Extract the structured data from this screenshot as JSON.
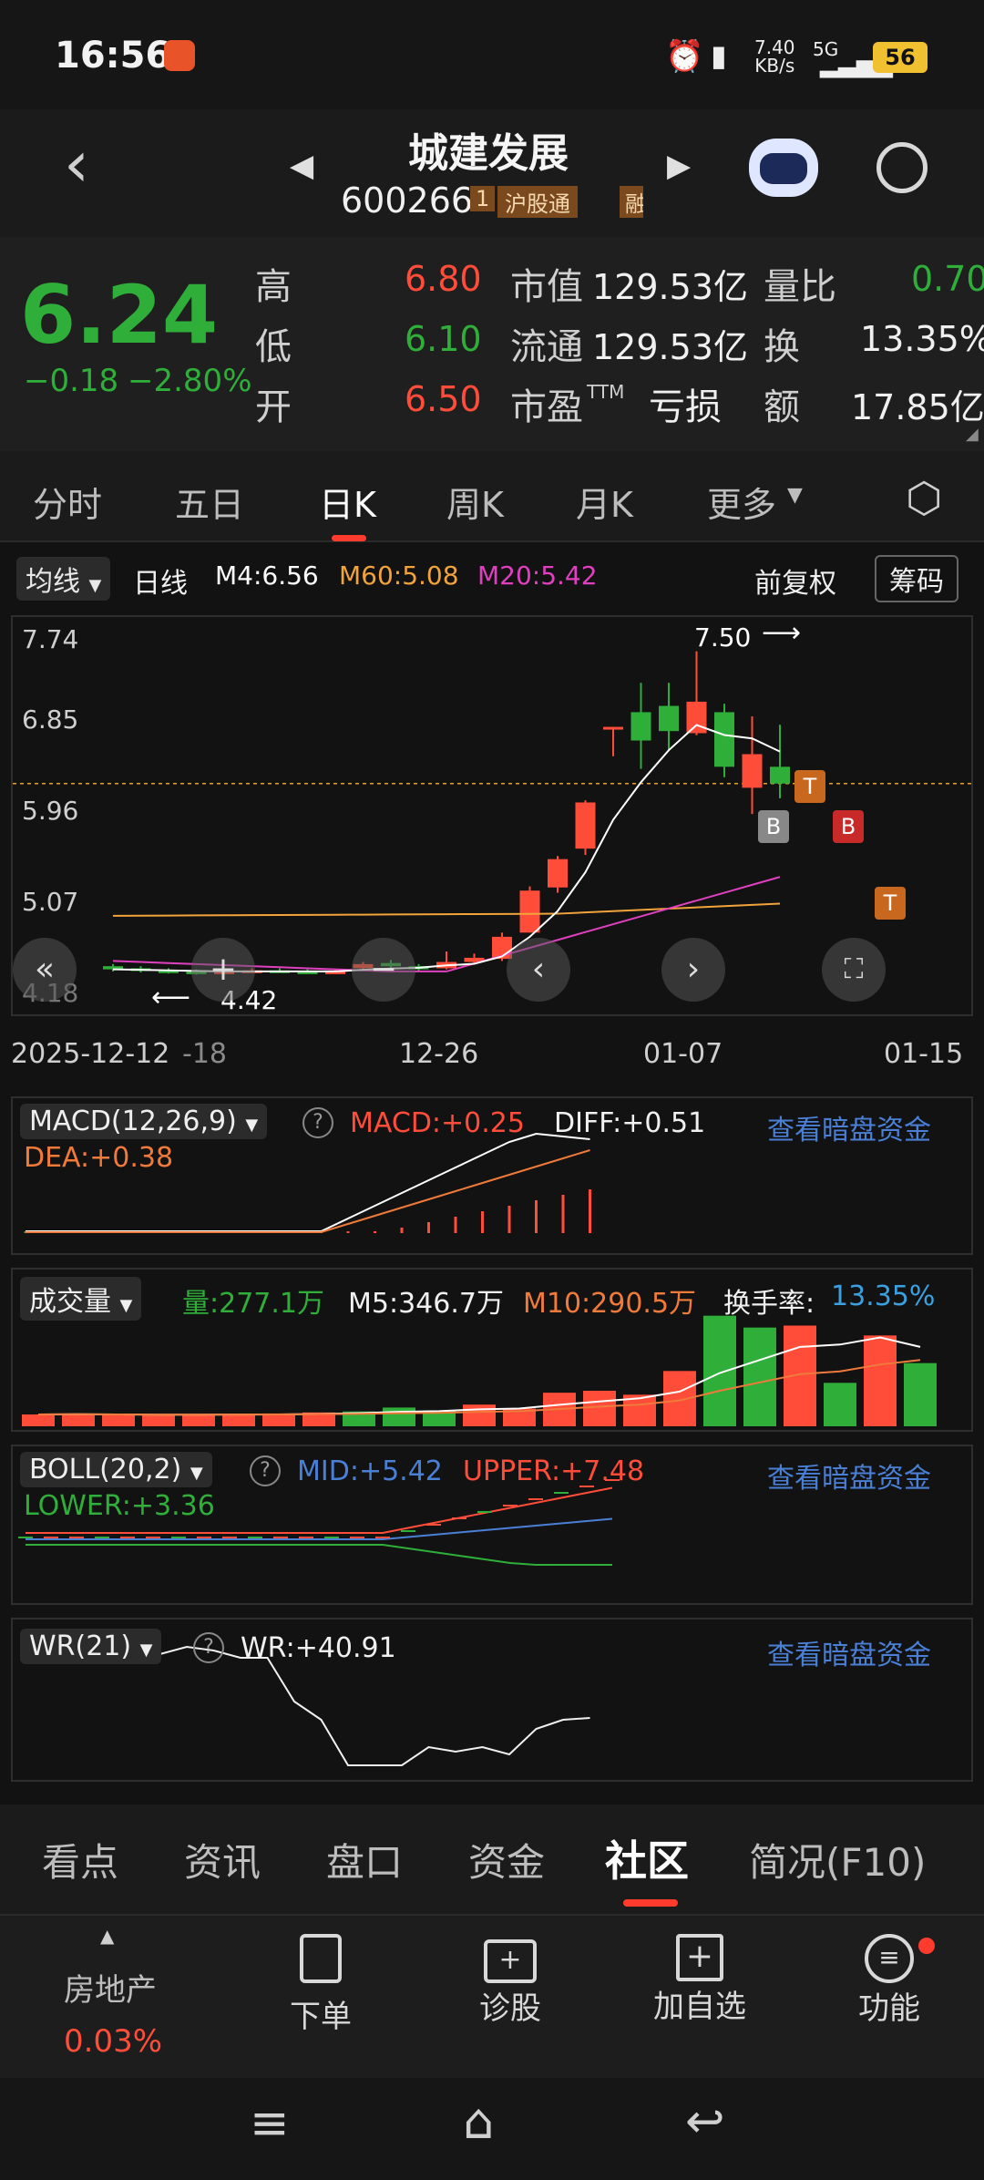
{
  "status_bar": {
    "time": "16:56",
    "net_speed": "7.40",
    "net_unit": "KB/s",
    "network": "5G",
    "battery": "56"
  },
  "header": {
    "stock_name": "城建发展",
    "stock_code": "600266",
    "tag1": "1",
    "tag2": "沪股通",
    "tag3": "融"
  },
  "quote": {
    "price": "6.24",
    "change": "−0.18",
    "change_pct": "−2.80%",
    "high_label": "高",
    "high": "6.80",
    "low_label": "低",
    "low": "6.10",
    "open_label": "开",
    "open": "6.50",
    "mcap_label": "市值",
    "mcap": "129.53亿",
    "float_label": "流通",
    "float": "129.53亿",
    "pe_label": "市盈",
    "pe_sup": "TTM",
    "pe": "亏损",
    "vr_label": "量比",
    "vr": "0.70",
    "turnover_label": "换",
    "turnover": "13.35%",
    "amount_label": "额",
    "amount": "17.85亿"
  },
  "period_tabs": [
    "分时",
    "五日",
    "日K",
    "周K",
    "月K",
    "更多"
  ],
  "kline": {
    "ma_selector": "均线",
    "period": "日线",
    "m4": "M4:6.56",
    "m60": "M60:5.08",
    "m20": "M20:5.42",
    "adjust": "前复权",
    "chip_button": "筹码",
    "y_ticks": [
      "7.74",
      "6.85",
      "5.96",
      "5.07",
      "4.18"
    ],
    "max_label": "7.50",
    "min_label": "4.42",
    "x_ticks": [
      "2025-12-12",
      "-18",
      "12-26",
      "01-07",
      "01-15"
    ],
    "markers": [
      "B",
      "T",
      "B",
      "T"
    ]
  },
  "macd": {
    "name": "MACD(12,26,9)",
    "macd": "MACD:+0.25",
    "diff": "DIFF:+0.51",
    "dea": "DEA:+0.38",
    "link": "查看暗盘资金"
  },
  "volume": {
    "name": "成交量",
    "vol": "量:277.1万",
    "m5": "M5:346.7万",
    "m10": "M10:290.5万",
    "turnover_label": "换手率:",
    "turnover": "13.35%"
  },
  "boll": {
    "name": "BOLL(20,2)",
    "mid": "MID:+5.42",
    "upper": "UPPER:+7.48",
    "lower": "LOWER:+3.36",
    "link": "查看暗盘资金"
  },
  "wr": {
    "name": "WR(21)",
    "wr": "WR:+40.91",
    "link": "查看暗盘资金"
  },
  "bottom_tabs": [
    "看点",
    "资讯",
    "盘口",
    "资金",
    "社区",
    "简况(F10)"
  ],
  "toolbar": {
    "sector_name": "房地产",
    "sector_change": "0.03%",
    "order": "下单",
    "diagnose": "诊股",
    "add_watch": "加自选",
    "functions": "功能"
  },
  "colors": {
    "up": "#ff4d3a",
    "down": "#2fae3a",
    "accent": "#4a7fd6"
  },
  "chart_data": {
    "type": "candlestick",
    "y_range": [
      4.18,
      7.74
    ],
    "candles": [
      {
        "o": 4.5,
        "c": 4.47,
        "h": 4.52,
        "l": 4.45
      },
      {
        "o": 4.48,
        "c": 4.46,
        "h": 4.5,
        "l": 4.44
      },
      {
        "o": 4.46,
        "c": 4.45,
        "h": 4.48,
        "l": 4.43
      },
      {
        "o": 4.45,
        "c": 4.44,
        "h": 4.47,
        "l": 4.42
      },
      {
        "o": 4.44,
        "c": 4.45,
        "h": 4.47,
        "l": 4.43
      },
      {
        "o": 4.45,
        "c": 4.46,
        "h": 4.48,
        "l": 4.44
      },
      {
        "o": 4.46,
        "c": 4.45,
        "h": 4.48,
        "l": 4.44
      },
      {
        "o": 4.45,
        "c": 4.44,
        "h": 4.47,
        "l": 4.43
      },
      {
        "o": 4.44,
        "c": 4.45,
        "h": 4.47,
        "l": 4.43
      },
      {
        "o": 4.48,
        "c": 4.52,
        "h": 4.54,
        "l": 4.47
      },
      {
        "o": 4.53,
        "c": 4.5,
        "h": 4.56,
        "l": 4.48
      },
      {
        "o": 4.5,
        "c": 4.47,
        "h": 4.52,
        "l": 4.45
      },
      {
        "o": 4.48,
        "c": 4.54,
        "h": 4.64,
        "l": 4.47
      },
      {
        "o": 4.54,
        "c": 4.58,
        "h": 4.62,
        "l": 4.52
      },
      {
        "o": 4.57,
        "c": 4.78,
        "h": 4.82,
        "l": 4.55
      },
      {
        "o": 4.82,
        "c": 5.22,
        "h": 5.26,
        "l": 4.82
      },
      {
        "o": 5.25,
        "c": 5.52,
        "h": 5.55,
        "l": 5.2
      },
      {
        "o": 5.62,
        "c": 6.06,
        "h": 6.08,
        "l": 5.56
      },
      {
        "o": 6.78,
        "c": 6.78,
        "h": 6.78,
        "l": 6.5
      },
      {
        "o": 6.92,
        "c": 6.65,
        "h": 7.2,
        "l": 6.38
      },
      {
        "o": 6.98,
        "c": 6.74,
        "h": 7.2,
        "l": 6.55
      },
      {
        "o": 6.72,
        "c": 7.02,
        "h": 7.5,
        "l": 6.7
      },
      {
        "o": 6.92,
        "c": 6.4,
        "h": 7.0,
        "l": 6.3
      },
      {
        "o": 6.2,
        "c": 6.52,
        "h": 6.88,
        "l": 5.95
      },
      {
        "o": 6.4,
        "c": 6.24,
        "h": 6.8,
        "l": 6.1
      }
    ],
    "volume": [
      {
        "v": 60,
        "up": true
      },
      {
        "v": 62,
        "up": true
      },
      {
        "v": 58,
        "up": true
      },
      {
        "v": 55,
        "up": true
      },
      {
        "v": 60,
        "up": true
      },
      {
        "v": 62,
        "up": true
      },
      {
        "v": 65,
        "up": true
      },
      {
        "v": 70,
        "up": true
      },
      {
        "v": 75,
        "up": false
      },
      {
        "v": 95,
        "up": false
      },
      {
        "v": 80,
        "up": false
      },
      {
        "v": 110,
        "up": true
      },
      {
        "v": 90,
        "up": true
      },
      {
        "v": 170,
        "up": true
      },
      {
        "v": 180,
        "up": true
      },
      {
        "v": 160,
        "up": true
      },
      {
        "v": 280,
        "up": true
      },
      {
        "v": 560,
        "up": false
      },
      {
        "v": 500,
        "up": false
      },
      {
        "v": 510,
        "up": true
      },
      {
        "v": 220,
        "up": false
      },
      {
        "v": 460,
        "up": true
      },
      {
        "v": 320,
        "up": false
      }
    ]
  }
}
